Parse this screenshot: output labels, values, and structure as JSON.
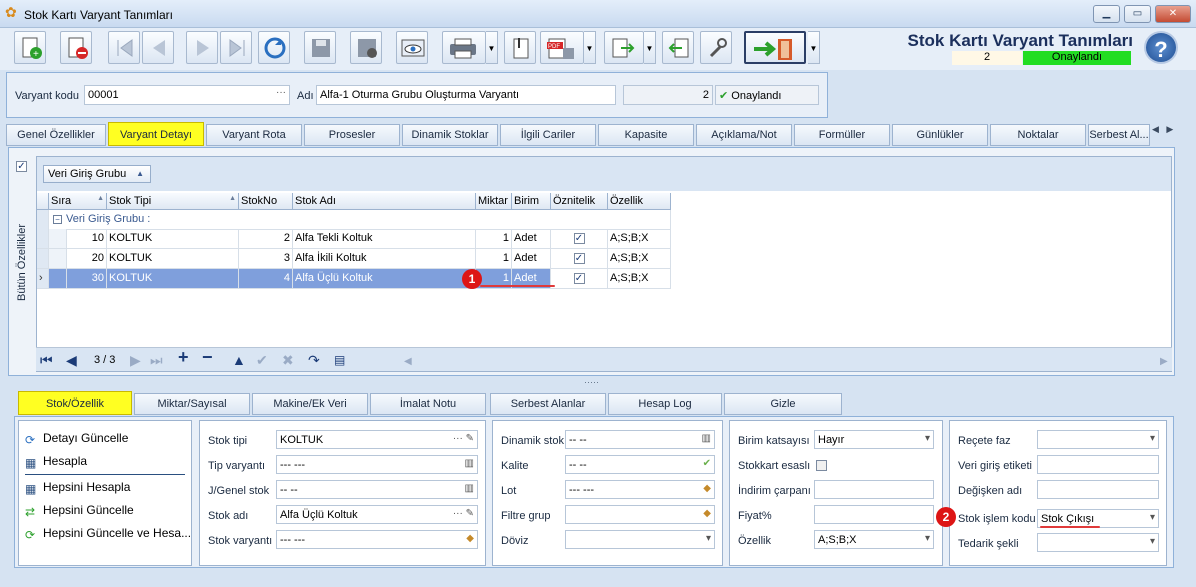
{
  "window": {
    "title": "Stok Kartı Varyant Tanımları"
  },
  "header": {
    "title": "Stok Kartı Varyant Tanımları",
    "count": "2",
    "status": "Onaylandı"
  },
  "variant": {
    "code_label": "Varyant kodu",
    "code_value": "00001",
    "name_label": "Adı",
    "name_value": "Alfa-1 Oturma Grubu Oluşturma Varyantı",
    "num_value": "2",
    "approved_label": "Onaylandı"
  },
  "tabs": [
    "Genel Özellikler",
    "Varyant Detayı",
    "Varyant Rota",
    "Prosesler",
    "Dinamik Stoklar",
    "İlgili Cariler",
    "Kapasite",
    "Açıklama/Not",
    "Formüller",
    "Günlükler",
    "Noktalar",
    "Serbest Al..."
  ],
  "side_label": "Bütün Özellikler",
  "grid": {
    "group_button": "Veri Giriş Grubu",
    "columns": [
      "Sıra",
      "Stok Tipi",
      "StokNo",
      "Stok Adı",
      "Miktar",
      "Birim",
      "Öznitelik",
      "Özellik"
    ],
    "group_row": "Veri Giriş Grubu :",
    "rows": [
      {
        "sira": "10",
        "tip": "KOLTUK",
        "no": "2",
        "adi": "Alfa Tekli Koltuk",
        "miktar": "1",
        "birim": "Adet",
        "oznitelik": "✓",
        "ozellik": "A;S;B;X"
      },
      {
        "sira": "20",
        "tip": "KOLTUK",
        "no": "3",
        "adi": "Alfa İkili Koltuk",
        "miktar": "1",
        "birim": "Adet",
        "oznitelik": "✓",
        "ozellik": "A;S;B;X"
      },
      {
        "sira": "30",
        "tip": "KOLTUK",
        "no": "4",
        "adi": "Alfa Üçlü Koltuk",
        "miktar": "1",
        "birim": "Adet",
        "oznitelik": "✓",
        "ozellik": "A;S;B;X"
      }
    ],
    "nav_page": "3 / 3"
  },
  "badges": {
    "b1": "1",
    "b2": "2"
  },
  "subtabs": [
    "Stok/Özellik",
    "Miktar/Sayısal",
    "Makine/Ek Veri",
    "İmalat Notu",
    "Serbest Alanlar",
    "Hesap Log",
    "Gizle"
  ],
  "actions": [
    "Detayı Güncelle",
    "Hesapla",
    "Hepsini Hesapla",
    "Hepsini Güncelle",
    "Hepsini Güncelle ve Hesa..."
  ],
  "stok_box": {
    "tip_label": "Stok tipi",
    "tip_value": "KOLTUK",
    "tipvar_label": "Tip varyantı",
    "tipvar_value": "--- ---",
    "jgenel_label": "J/Genel stok",
    "jgenel_value": "-- --",
    "adi_label": "Stok adı",
    "adi_value": "Alfa Üçlü Koltuk",
    "varyant_label": "Stok varyantı",
    "varyant_value": "--- ---"
  },
  "dinamik_box": {
    "dinamik_label": "Dinamik stok",
    "dinamik_value": "-- --",
    "kalite_label": "Kalite",
    "kalite_value": "-- --",
    "lot_label": "Lot",
    "lot_value": "--- ---",
    "filtre_label": "Filtre grup",
    "filtre_value": "",
    "doviz_label": "Döviz",
    "doviz_value": ""
  },
  "birim_box": {
    "katsayi_label": "Birim katsayısı",
    "katsayi_value": "Hayır",
    "esasli_label": "Stokkart esaslı",
    "indirim_label": "İndirim çarpanı",
    "indirim_value": "",
    "fiyat_label": "Fiyat%",
    "fiyat_value": "",
    "ozellik_label": "Özellik",
    "ozellik_value": "A;S;B;X"
  },
  "recete_box": {
    "recete_label": "Reçete faz",
    "recete_value": "",
    "etiket_label": "Veri giriş etiketi",
    "etiket_value": "",
    "degisken_label": "Değişken adı",
    "degisken_value": "",
    "islem_label": "Stok işlem kodu",
    "islem_value": "Stok Çıkışı",
    "tedarik_label": "Tedarik şekli",
    "tedarik_value": ""
  }
}
